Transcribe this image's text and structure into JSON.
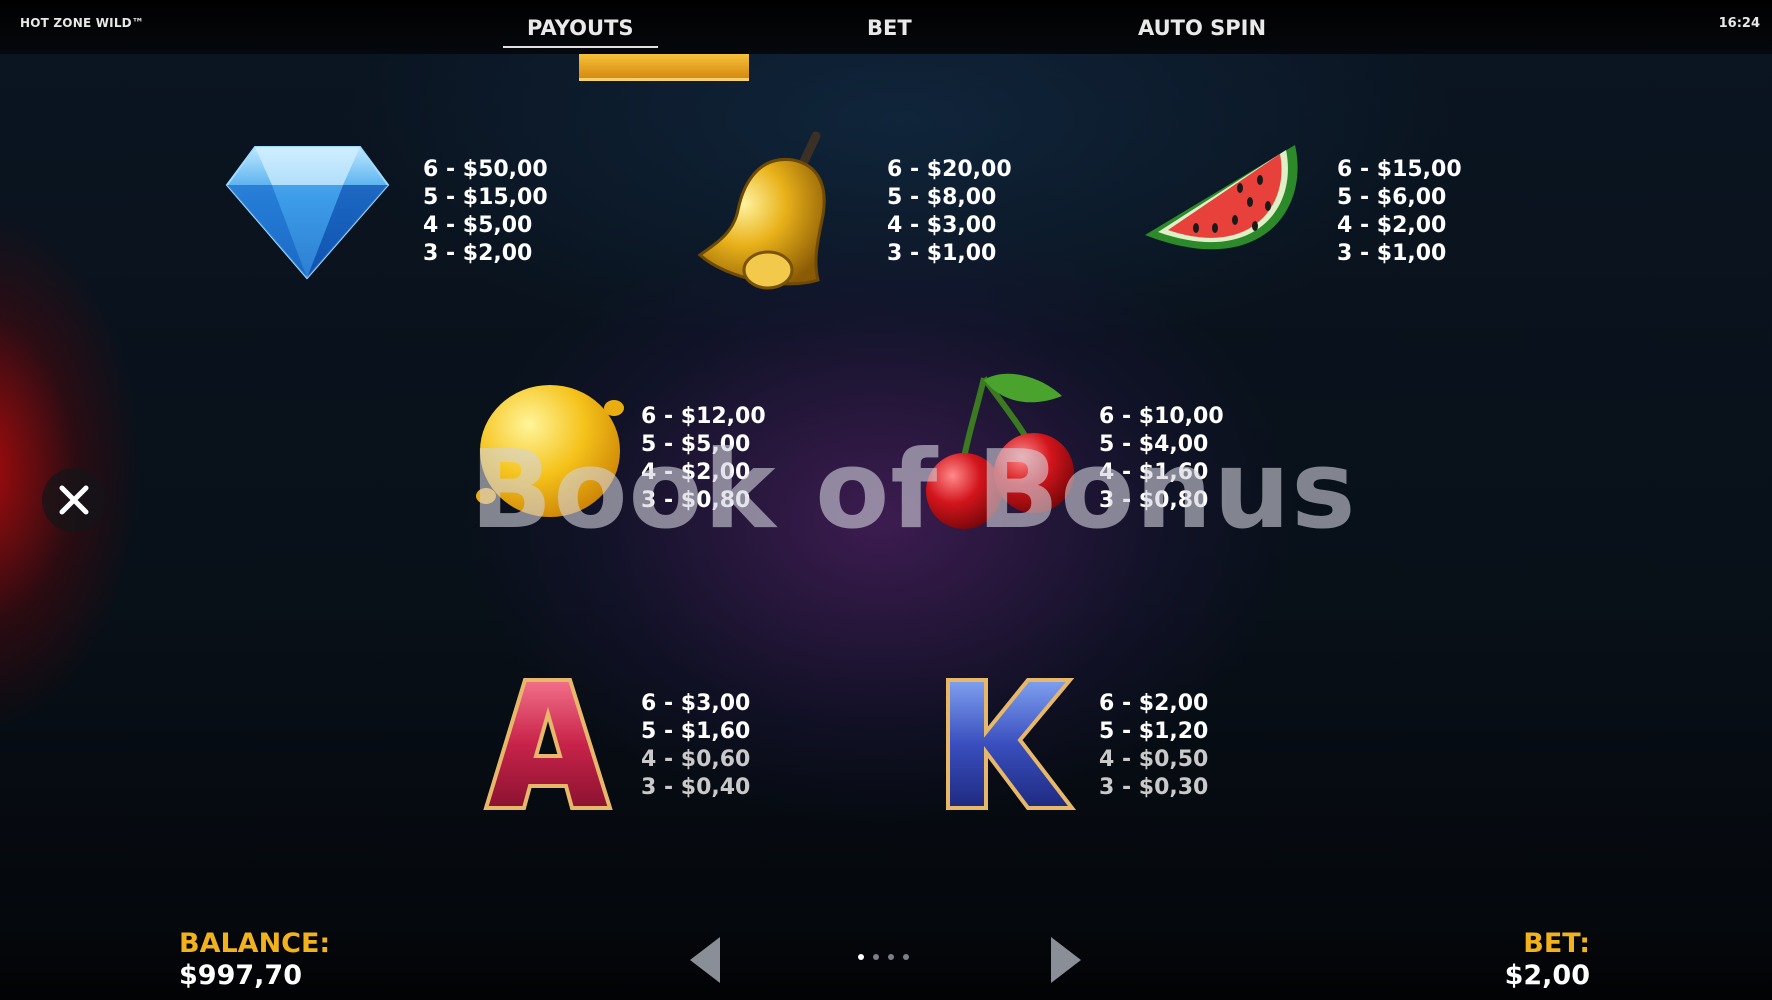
{
  "header": {
    "game_title": "HOT ZONE WILD™",
    "clock": "16:24",
    "tabs": [
      {
        "label": "PAYOUTS",
        "active": true
      },
      {
        "label": "BET",
        "active": false
      },
      {
        "label": "AUTO SPIN",
        "active": false
      }
    ]
  },
  "symbols": {
    "diamond": {
      "icon": "diamond-icon",
      "payouts": [
        "6 - $50,00",
        "5 - $15,00",
        "4 - $5,00",
        "3 - $2,00"
      ]
    },
    "bell": {
      "icon": "bell-icon",
      "payouts": [
        "6 - $20,00",
        "5 - $8,00",
        "4 - $3,00",
        "3 - $1,00"
      ]
    },
    "watermelon": {
      "icon": "watermelon-icon",
      "payouts": [
        "6 - $15,00",
        "5 - $6,00",
        "4 - $2,00",
        "3 - $1,00"
      ]
    },
    "lemon": {
      "icon": "lemon-icon",
      "payouts": [
        "6 - $12,00",
        "5 - $5,00",
        "4 - $2,00",
        "3 - $0,80"
      ]
    },
    "cherry": {
      "icon": "cherry-icon",
      "payouts": [
        "6 - $10,00",
        "5 - $4,00",
        "4 - $1,60",
        "3 - $0,80"
      ]
    },
    "letter_a": {
      "icon": "letter-a-icon",
      "glyph": "A",
      "payouts": [
        "6 - $3,00",
        "5 - $1,60",
        "4 - $0,60",
        "3 - $0,40"
      ]
    },
    "letter_k": {
      "icon": "letter-k-icon",
      "glyph": "K",
      "payouts": [
        "6 - $2,00",
        "5 - $1,20",
        "4 - $0,50",
        "3 - $0,30"
      ]
    }
  },
  "watermark": "Book of Bonus",
  "footer": {
    "balance_label": "BALANCE:",
    "balance_value": "$997,70",
    "bet_label": "BET:",
    "bet_value": "$2,00",
    "page_count": 4,
    "current_page": 1
  },
  "colors": {
    "accent_gold": "#f2b21d",
    "background": "#081018"
  }
}
